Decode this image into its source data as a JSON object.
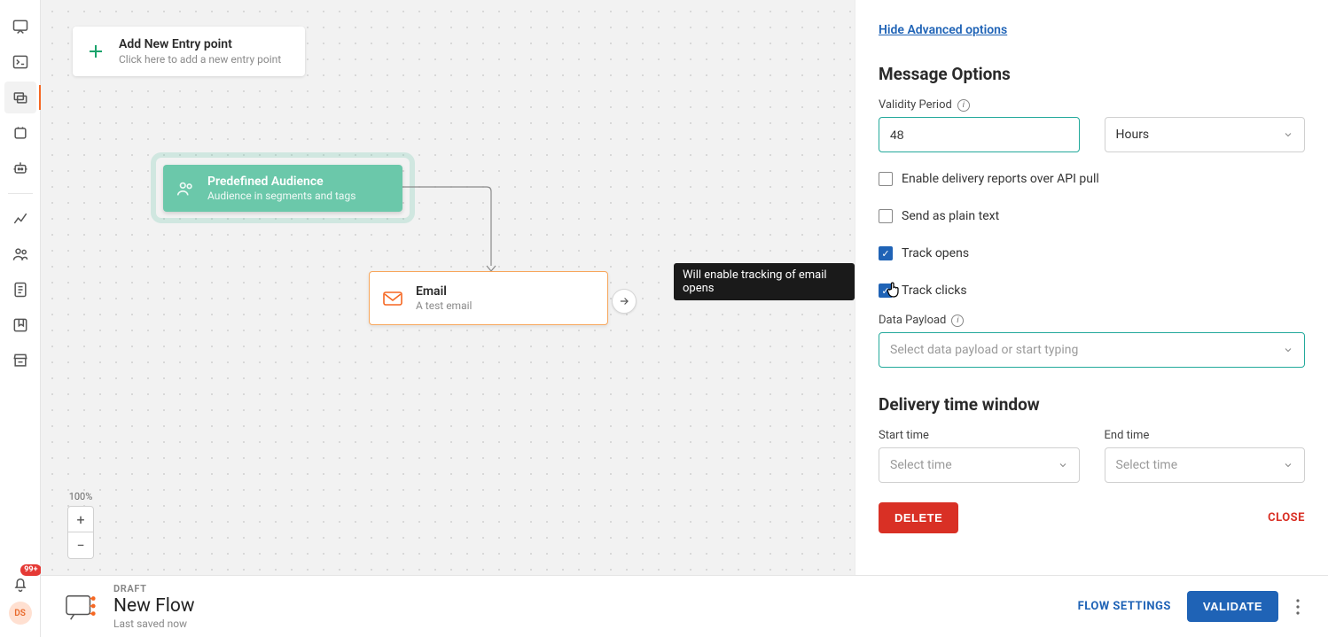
{
  "rail": {
    "badge": "99+",
    "avatar": "DS"
  },
  "canvas": {
    "entryCard": {
      "title": "Add New Entry point",
      "subtitle": "Click here to add a new entry point"
    },
    "audience": {
      "title": "Predefined Audience",
      "subtitle": "Audience in segments and tags"
    },
    "email": {
      "title": "Email",
      "subtitle": "A test email"
    },
    "tooltip": "Will enable tracking of email opens",
    "zoom": {
      "label": "100%"
    }
  },
  "panel": {
    "advanced": "Hide Advanced options",
    "section1": "Message Options",
    "validity": {
      "label": "Validity Period",
      "value": "48",
      "unit": "Hours"
    },
    "cbDelivery": "Enable delivery reports over API pull",
    "cbPlain": "Send as plain text",
    "cbOpens": "Track opens",
    "cbClicks": "Track clicks",
    "payload": {
      "label": "Data Payload",
      "placeholder": "Select data payload or start typing"
    },
    "section2": "Delivery time window",
    "start": {
      "label": "Start time",
      "placeholder": "Select time"
    },
    "end": {
      "label": "End time",
      "placeholder": "Select time"
    },
    "delete": "DELETE",
    "close": "CLOSE"
  },
  "footer": {
    "status": "DRAFT",
    "title": "New Flow",
    "saved": "Last saved now",
    "settings": "FLOW SETTINGS",
    "validate": "VALIDATE"
  }
}
